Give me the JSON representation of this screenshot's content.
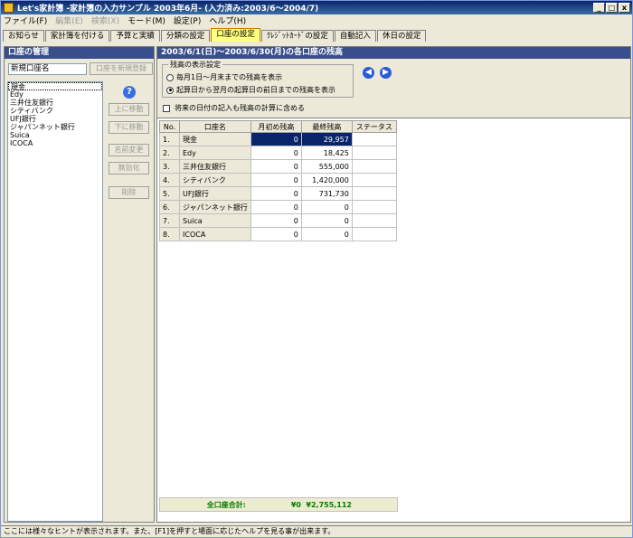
{
  "window": {
    "title": "Let's家計簿 -家計簿の入力サンプル 2003年6月- (入力済み:2003/6～2004/7)",
    "min_label": "_",
    "max_label": "□",
    "close_label": "x"
  },
  "menu": [
    "ファイル(F)",
    "編集(E)",
    "検索(X)",
    "モード(M)",
    "設定(P)",
    "ヘルプ(H)"
  ],
  "tabs": [
    "お知らせ",
    "家計簿を付ける",
    "予算と実績",
    "分類の設定",
    "口座の設定",
    "ｸﾚｼﾞｯﾄｶｰﾄﾞの設定",
    "自動記入",
    "休日の設定"
  ],
  "left": {
    "header": "口座の管理",
    "new_account_value": "新規口座名",
    "new_account_button": "口座を新規登録",
    "accounts": [
      "現金",
      "Edy",
      "三井住友銀行",
      "シティバンク",
      "UFJ銀行",
      "ジャパンネット銀行",
      "Suica",
      "ICOCA"
    ],
    "help": "?",
    "btn_up": "上に移動",
    "btn_down": "下に移動",
    "btn_rename": "名前変更",
    "btn_disable": "無効化",
    "btn_delete": "削除"
  },
  "right": {
    "header": "2003/6/1(日)～2003/6/30(月)の各口座の残高",
    "display_legend": "残高の表示設定",
    "radio1": "毎月1日～月末までの残高を表示",
    "radio2": "起算日から翌月の起算日の前日までの残高を表示",
    "prev_label": "◀",
    "next_label": "▶",
    "future_check": "将来の日付の記入も残高の計算に含める",
    "columns": [
      "No.",
      "口座名",
      "月初め残高",
      "最終残高",
      "ステータス"
    ],
    "rows": [
      {
        "no": "1.",
        "name": "現金",
        "start": "0",
        "end": "29,957",
        "status": ""
      },
      {
        "no": "2.",
        "name": "Edy",
        "start": "0",
        "end": "18,425",
        "status": ""
      },
      {
        "no": "3.",
        "name": "三井住友銀行",
        "start": "0",
        "end": "555,000",
        "status": ""
      },
      {
        "no": "4.",
        "name": "シティバンク",
        "start": "0",
        "end": "1,420,000",
        "status": ""
      },
      {
        "no": "5.",
        "name": "UFJ銀行",
        "start": "0",
        "end": "731,730",
        "status": ""
      },
      {
        "no": "6.",
        "name": "ジャパンネット銀行",
        "start": "0",
        "end": "0",
        "status": ""
      },
      {
        "no": "7.",
        "name": "Suica",
        "start": "0",
        "end": "0",
        "status": ""
      },
      {
        "no": "8.",
        "name": "ICOCA",
        "start": "0",
        "end": "0",
        "status": ""
      }
    ],
    "total_label": "全口座合計:",
    "total_start": "¥0",
    "total_end": "¥2,755,112"
  },
  "status": "ここには様々なヒントが表示されます。また、[F1]を押すと場面に応じたヘルプを見る事が出来ます。"
}
